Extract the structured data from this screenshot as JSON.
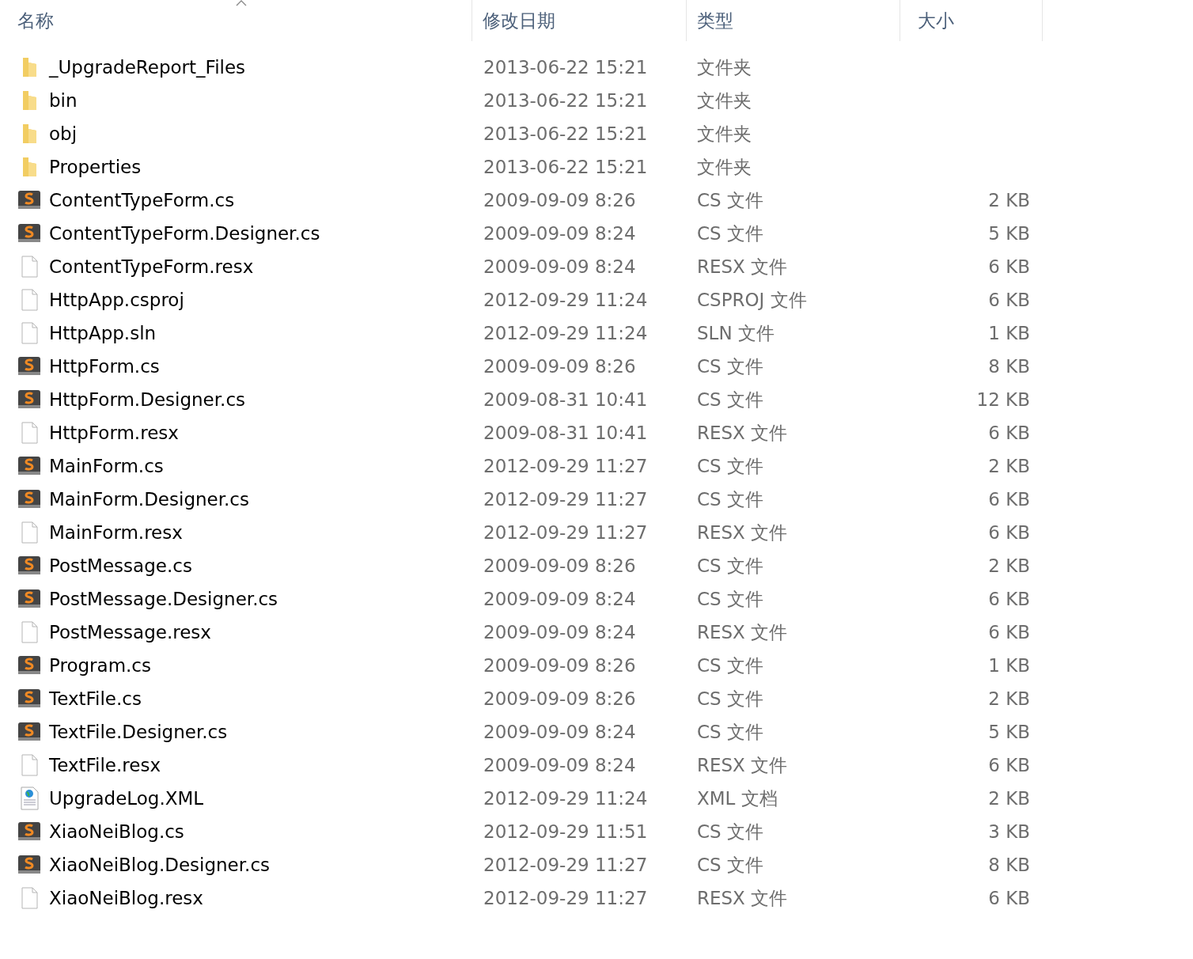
{
  "columns": [
    {
      "label": "名称",
      "sorted": true
    },
    {
      "label": "修改日期",
      "sorted": false
    },
    {
      "label": "类型",
      "sorted": false
    },
    {
      "label": "大小",
      "sorted": false
    }
  ],
  "files": [
    {
      "kind": "folder",
      "name": "_UpgradeReport_Files",
      "modified": "2013-06-22 15:21",
      "type": "文件夹"
    },
    {
      "kind": "folder",
      "name": "bin",
      "modified": "2013-06-22 15:21",
      "type": "文件夹"
    },
    {
      "kind": "folder",
      "name": "obj",
      "modified": "2013-06-22 15:21",
      "type": "文件夹"
    },
    {
      "kind": "folder",
      "name": "Properties",
      "modified": "2013-06-22 15:21",
      "type": "文件夹"
    },
    {
      "kind": "cs",
      "name": "ContentTypeForm.cs",
      "modified": "2009-09-09 8:26",
      "type": "CS 文件",
      "size": "2 KB"
    },
    {
      "kind": "cs",
      "name": "ContentTypeForm.Designer.cs",
      "modified": "2009-09-09 8:24",
      "type": "CS 文件",
      "size": "5 KB"
    },
    {
      "kind": "blank",
      "name": "ContentTypeForm.resx",
      "modified": "2009-09-09 8:24",
      "type": "RESX 文件",
      "size": "6 KB"
    },
    {
      "kind": "blank",
      "name": "HttpApp.csproj",
      "modified": "2012-09-29 11:24",
      "type": "CSPROJ 文件",
      "size": "6 KB"
    },
    {
      "kind": "blank",
      "name": "HttpApp.sln",
      "modified": "2012-09-29 11:24",
      "type": "SLN 文件",
      "size": "1 KB"
    },
    {
      "kind": "cs",
      "name": "HttpForm.cs",
      "modified": "2009-09-09 8:26",
      "type": "CS 文件",
      "size": "8 KB"
    },
    {
      "kind": "cs",
      "name": "HttpForm.Designer.cs",
      "modified": "2009-08-31 10:41",
      "type": "CS 文件",
      "size": "12 KB"
    },
    {
      "kind": "blank",
      "name": "HttpForm.resx",
      "modified": "2009-08-31 10:41",
      "type": "RESX 文件",
      "size": "6 KB"
    },
    {
      "kind": "cs",
      "name": "MainForm.cs",
      "modified": "2012-09-29 11:27",
      "type": "CS 文件",
      "size": "2 KB"
    },
    {
      "kind": "cs",
      "name": "MainForm.Designer.cs",
      "modified": "2012-09-29 11:27",
      "type": "CS 文件",
      "size": "6 KB"
    },
    {
      "kind": "blank",
      "name": "MainForm.resx",
      "modified": "2012-09-29 11:27",
      "type": "RESX 文件",
      "size": "6 KB"
    },
    {
      "kind": "cs",
      "name": "PostMessage.cs",
      "modified": "2009-09-09 8:26",
      "type": "CS 文件",
      "size": "2 KB"
    },
    {
      "kind": "cs",
      "name": "PostMessage.Designer.cs",
      "modified": "2009-09-09 8:24",
      "type": "CS 文件",
      "size": "6 KB"
    },
    {
      "kind": "blank",
      "name": "PostMessage.resx",
      "modified": "2009-09-09 8:24",
      "type": "RESX 文件",
      "size": "6 KB"
    },
    {
      "kind": "cs",
      "name": "Program.cs",
      "modified": "2009-09-09 8:26",
      "type": "CS 文件",
      "size": "1 KB"
    },
    {
      "kind": "cs",
      "name": "TextFile.cs",
      "modified": "2009-09-09 8:26",
      "type": "CS 文件",
      "size": "2 KB"
    },
    {
      "kind": "cs",
      "name": "TextFile.Designer.cs",
      "modified": "2009-09-09 8:24",
      "type": "CS 文件",
      "size": "5 KB"
    },
    {
      "kind": "blank",
      "name": "TextFile.resx",
      "modified": "2009-09-09 8:24",
      "type": "RESX 文件",
      "size": "6 KB"
    },
    {
      "kind": "xml",
      "name": "UpgradeLog.XML",
      "modified": "2012-09-29 11:24",
      "type": "XML 文档",
      "size": "2 KB"
    },
    {
      "kind": "cs",
      "name": "XiaoNeiBlog.cs",
      "modified": "2012-09-29 11:51",
      "type": "CS 文件",
      "size": "3 KB"
    },
    {
      "kind": "cs",
      "name": "XiaoNeiBlog.Designer.cs",
      "modified": "2012-09-29 11:27",
      "type": "CS 文件",
      "size": "8 KB"
    },
    {
      "kind": "blank",
      "name": "XiaoNeiBlog.resx",
      "modified": "2012-09-29 11:27",
      "type": "RESX 文件",
      "size": "6 KB"
    }
  ]
}
